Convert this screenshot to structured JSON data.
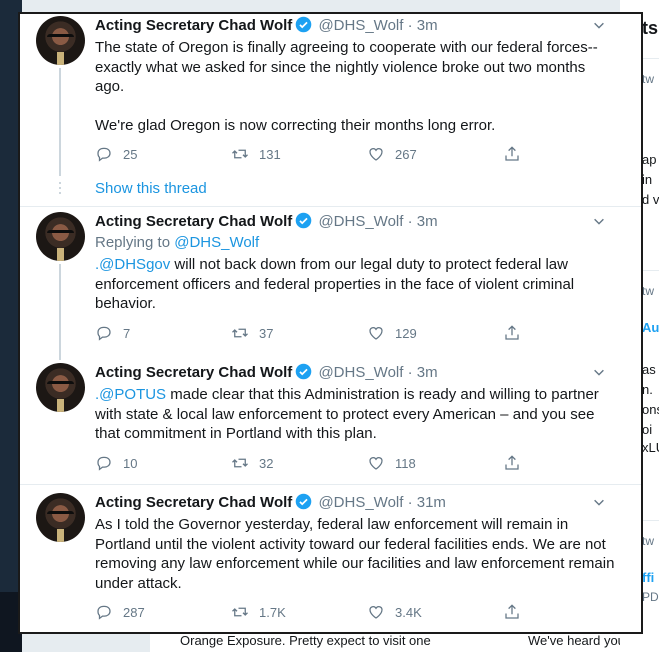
{
  "background": {
    "right_fragments": [
      "ts",
      "tw",
      "ap",
      "in",
      "d v",
      "tw",
      "Au",
      "as",
      "n.",
      "ons",
      "oi",
      "xLU",
      "tw",
      "ffi",
      "PDX"
    ],
    "bottom_fragments": [
      "Orange Exposure. Pretty expect to visit one",
      "We've heard your ca"
    ]
  },
  "tweets": [
    {
      "name": "Acting Secretary Chad Wolf",
      "handle": "@DHS_Wolf",
      "sep": "·",
      "time": "3m",
      "paragraphs": [
        "The state of Oregon is finally agreeing to cooperate with our federal forces--exactly what we asked for since the nightly violence broke out two months ago.",
        "We're glad Oregon is now correcting their months long error."
      ],
      "replies": "25",
      "retweets": "131",
      "likes": "267",
      "show_thread": "Show this thread"
    },
    {
      "name": "Acting Secretary Chad Wolf",
      "handle": "@DHS_Wolf",
      "sep": "·",
      "time": "3m",
      "replying_label": "Replying to",
      "replying_handle": "@DHS_Wolf",
      "mention": ".@DHSgov",
      "body": " will not back down from our legal duty to protect federal law enforcement officers and federal properties in the face of violent criminal behavior.",
      "replies": "7",
      "retweets": "37",
      "likes": "129"
    },
    {
      "name": "Acting Secretary Chad Wolf",
      "handle": "@DHS_Wolf",
      "sep": "·",
      "time": "3m",
      "mention": ".@POTUS",
      "body": " made clear that this Administration is ready and willing to partner with state & local law enforcement to protect every American – and you see that commitment in Portland with this plan.",
      "replies": "10",
      "retweets": "32",
      "likes": "118"
    },
    {
      "name": "Acting Secretary Chad Wolf",
      "handle": "@DHS_Wolf",
      "sep": "·",
      "time": "31m",
      "body": "As I told the Governor yesterday, federal law enforcement will remain in Portland until the violent activity toward our federal facilities ends. We are not removing any law enforcement while our facilities and law enforcement remain under attack.",
      "replies": "287",
      "retweets": "1.7K",
      "likes": "3.4K"
    }
  ],
  "colors": {
    "accent": "#1da1f2",
    "link": "#1b95e0",
    "muted": "#657786",
    "text": "#14171a",
    "divider": "#e6ecf0"
  },
  "icons": [
    "verified-badge-icon",
    "chevron-down-icon",
    "reply-icon",
    "retweet-icon",
    "like-icon",
    "share-icon"
  ]
}
